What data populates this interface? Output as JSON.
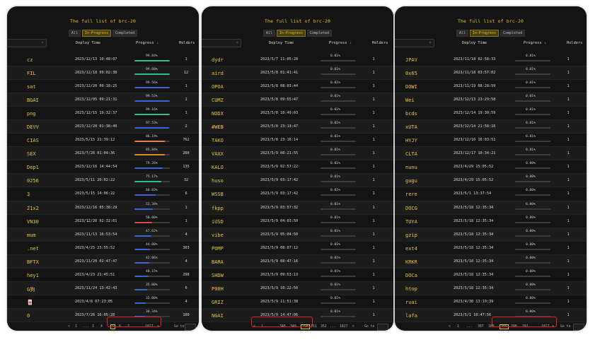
{
  "app": {
    "title": "The full list of brc-20"
  },
  "tabs": [
    "All",
    "In-Progress",
    "Completed"
  ],
  "headers": {
    "deploy_time": "Deploy Time",
    "progress": "Progress",
    "sort_arrow": "↓",
    "holders": "Holders"
  },
  "colors": {
    "accent": "#e8c23a",
    "bar_green": "#2fbf8a",
    "bar_blue": "#3a63d8",
    "bar_red": "#e04848",
    "bar_orange": "#e0852a",
    "highlight": "#e0202a"
  },
  "panels": [
    {
      "rows": [
        {
          "ticker": "cz",
          "time": "2023/12/13 10:48:07",
          "progress": "99.84%",
          "level": 0.998,
          "color": "green",
          "holders": "1"
        },
        {
          "ticker": "FIL",
          "time": "2023/12/18 09:02:38",
          "progress": "99.60%",
          "level": 0.996,
          "color": "green",
          "holders": "12"
        },
        {
          "ticker": "sat",
          "time": "2023/12/20 00:10:25",
          "progress": "99.56%",
          "level": 0.995,
          "color": "blue",
          "holders": "1"
        },
        {
          "ticker": "BGAI",
          "time": "2023/12/05 09:21:31",
          "progress": "99.53%",
          "level": 0.995,
          "color": "blue",
          "holders": "1"
        },
        {
          "ticker": "png",
          "time": "2023/12/15 19:32:37",
          "progress": "99.16%",
          "level": 0.991,
          "color": "green",
          "holders": "1"
        },
        {
          "ticker": "DEVV",
          "time": "2023/12/20 01:38:40",
          "progress": "97.53%",
          "level": 0.975,
          "color": "blue",
          "holders": "2"
        },
        {
          "ticker": "CIAS",
          "time": "2023/5/15 21:39:12",
          "progress": "86.19%",
          "level": 0.862,
          "color": "orange",
          "holders": "762"
        },
        {
          "ticker": "SEX",
          "time": "2023/7/26 01:04:36",
          "progress": "85.84%",
          "level": 0.858,
          "color": "orange",
          "holders": "260"
        },
        {
          "ticker": "Dep1",
          "time": "2023/12/16 14:44:54",
          "progress": "79.26%",
          "level": 0.793,
          "color": "blue",
          "holders": "135"
        },
        {
          "ticker": "0256",
          "time": "2023/5/11 20:02:22",
          "progress": "75.17%",
          "level": 0.752,
          "color": "green",
          "holders": "32"
        },
        {
          "ticker": "3",
          "time": "2023/5/15 14:06:22",
          "progress": "60.03%",
          "level": 0.6,
          "color": "blue",
          "holders": "6"
        },
        {
          "ticker": "21x2",
          "time": "2023/12/16 05:38:29",
          "progress": "52.38%",
          "level": 0.524,
          "color": "blue",
          "holders": "1"
        },
        {
          "ticker": "VN30",
          "time": "2023/12/20 02:32:01",
          "progress": "50.00%",
          "level": 0.5,
          "color": "red",
          "holders": "1"
        },
        {
          "ticker": "mum",
          "time": "2023/11/13 16:53:54",
          "progress": "47.62%",
          "level": 0.476,
          "color": "blue",
          "holders": "4"
        },
        {
          "ticker": ".net",
          "time": "2023/4/25 23:55:52",
          "progress": "44.00%",
          "level": 0.44,
          "color": "blue",
          "holders": "303"
        },
        {
          "ticker": "BFTX",
          "time": "2023/11/20 02:47:47",
          "progress": "42.86%",
          "level": 0.429,
          "color": "blue",
          "holders": "4"
        },
        {
          "ticker": "hey1",
          "time": "2023/4/23 21:45:51",
          "progress": "40.15%",
          "level": 0.402,
          "color": "blue",
          "holders": "298"
        },
        {
          "ticker": "G狗",
          "time": "2023/11/24 13:42:43",
          "progress": "35.00%",
          "level": 0.35,
          "color": "blue",
          "holders": "6"
        },
        {
          "ticker": "🀄",
          "time": "2023/4/8 07:23:05",
          "progress": "32.00%",
          "level": 0.32,
          "color": "blue",
          "holders": "4"
        },
        {
          "ticker": "0",
          "time": "2023/7/26 16:05:28",
          "progress": "30.34%",
          "level": 0.303,
          "color": "blue",
          "holders": "100"
        }
      ],
      "pager": [
        "<",
        "1",
        "...",
        "3",
        "4",
        "5",
        "6",
        "7",
        "...",
        "1827",
        ">"
      ],
      "current": "5",
      "goto": "Go to",
      "goto_suffix": "Page"
    },
    {
      "rows": [
        {
          "ticker": "dydr",
          "time": "2023/5/7 11:05:28",
          "progress": "0.01%",
          "level": 0.0001,
          "color": "blue",
          "holders": "1"
        },
        {
          "ticker": "aird",
          "time": "2023/5/8 01:41:41",
          "progress": "0.01%",
          "level": 0.0001,
          "color": "blue",
          "holders": "1"
        },
        {
          "ticker": "OPOA",
          "time": "2023/5/8 08:03:44",
          "progress": "0.01%",
          "level": 0.0001,
          "color": "blue",
          "holders": "1"
        },
        {
          "ticker": "CUMZ",
          "time": "2023/5/8 09:55:47",
          "progress": "0.01%",
          "level": 0.0001,
          "color": "blue",
          "holders": "1"
        },
        {
          "ticker": "NODX",
          "time": "2023/5/8 10:49:03",
          "progress": "0.01%",
          "level": 0.0001,
          "color": "blue",
          "holders": "1"
        },
        {
          "ticker": "#WEB",
          "time": "2023/5/8 23:13:47",
          "progress": "0.01%",
          "level": 0.0001,
          "color": "blue",
          "holders": "1"
        },
        {
          "ticker": "TAKO",
          "time": "2023/5/8 23:16:14",
          "progress": "0.01%",
          "level": 0.0001,
          "color": "blue",
          "holders": "1"
        },
        {
          "ticker": "VAXX",
          "time": "2023/5/9 00:21:55",
          "progress": "0.01%",
          "level": 0.0001,
          "color": "blue",
          "holders": "1"
        },
        {
          "ticker": "KALO",
          "time": "2023/5/9 02:57:22",
          "progress": "0.01%",
          "level": 0.0001,
          "color": "blue",
          "holders": "1"
        },
        {
          "ticker": "huso",
          "time": "2023/5/9 03:17:42",
          "progress": "0.01%",
          "level": 0.0001,
          "color": "blue",
          "holders": "1"
        },
        {
          "ticker": "WSSB",
          "time": "2023/5/9 03:17:42",
          "progress": "0.01%",
          "level": 0.0001,
          "color": "blue",
          "holders": "1"
        },
        {
          "ticker": "fkpp",
          "time": "2023/5/9 03:57:32",
          "progress": "0.01%",
          "level": 0.0001,
          "color": "blue",
          "holders": "1"
        },
        {
          "ticker": "iUSD",
          "time": "2023/5/9 04:03:50",
          "progress": "0.01%",
          "level": 0.0001,
          "color": "blue",
          "holders": "1"
        },
        {
          "ticker": "vibe",
          "time": "2023/5/9 05:04:50",
          "progress": "0.01%",
          "level": 0.0001,
          "color": "blue",
          "holders": "1"
        },
        {
          "ticker": "POMP",
          "time": "2023/5/9 08:07:12",
          "progress": "0.01%",
          "level": 0.0001,
          "color": "blue",
          "holders": "1"
        },
        {
          "ticker": "BARA",
          "time": "2023/5/9 08:47:16",
          "progress": "0.01%",
          "level": 0.0001,
          "color": "blue",
          "holders": "1"
        },
        {
          "ticker": "SHDW",
          "time": "2023/5/9 09:53:13",
          "progress": "0.01%",
          "level": 0.0001,
          "color": "blue",
          "holders": "1"
        },
        {
          "ticker": "P00H",
          "time": "2023/5/9 10:22:50",
          "progress": "0.01%",
          "level": 0.0001,
          "color": "blue",
          "holders": "1"
        },
        {
          "ticker": "GRIZ",
          "time": "2023/5/9 11:51:38",
          "progress": "0.01%",
          "level": 0.0001,
          "color": "blue",
          "holders": "1"
        },
        {
          "ticker": "NGAI",
          "time": "2023/5/9 14:47:06",
          "progress": "0.01%",
          "level": 0.0001,
          "color": "blue",
          "holders": "1"
        }
      ],
      "pager": [
        "<",
        "1",
        "...",
        "348",
        "349",
        "350",
        "351",
        "352",
        "...",
        "1827",
        ">"
      ],
      "current": "350",
      "goto": "Go to",
      "goto_suffix": ""
    },
    {
      "rows": [
        {
          "ticker": "JPAV",
          "time": "2023/11/18 02:58:33",
          "progress": "0.01%",
          "level": 0.0001,
          "color": "blue",
          "holders": "1"
        },
        {
          "ticker": "0x65",
          "time": "2023/11/18 03:57:02",
          "progress": "0.01%",
          "level": 0.0001,
          "color": "blue",
          "holders": "1"
        },
        {
          "ticker": "DOWI",
          "time": "2023/11/19 08:28:59",
          "progress": "0.01%",
          "level": 0.0001,
          "color": "blue",
          "holders": "1"
        },
        {
          "ticker": "Wei",
          "time": "2023/12/13 23:29:58",
          "progress": "0.01%",
          "level": 0.0001,
          "color": "blue",
          "holders": "1"
        },
        {
          "ticker": "bcds",
          "time": "2023/12/14 19:30:59",
          "progress": "0.01%",
          "level": 0.0001,
          "color": "blue",
          "holders": "1"
        },
        {
          "ticker": "xUTA",
          "time": "2023/12/14 21:58:16",
          "progress": "0.01%",
          "level": 0.0001,
          "color": "blue",
          "holders": "1"
        },
        {
          "ticker": "HYJY",
          "time": "2023/12/16 16:03:51",
          "progress": "0.01%",
          "level": 0.0001,
          "color": "blue",
          "holders": "1"
        },
        {
          "ticker": "CLTA",
          "time": "2023/12/17 10:34:21",
          "progress": "0.01%",
          "level": 0.0001,
          "color": "blue",
          "holders": "1"
        },
        {
          "ticker": "nunu",
          "time": "2023/4/29 15:05:52",
          "progress": "0.00%",
          "level": 0.0,
          "color": "blue",
          "holders": "1"
        },
        {
          "ticker": "gugu",
          "time": "2023/4/29 15:05:52",
          "progress": "0.00%",
          "level": 0.0,
          "color": "blue",
          "holders": "1"
        },
        {
          "ticker": "rere",
          "time": "2023/5/1 13:37:54",
          "progress": "0.00%",
          "level": 0.0,
          "color": "blue",
          "holders": "1"
        },
        {
          "ticker": "DOCG",
          "time": "2023/5/18 12:35:34",
          "progress": "0.00%",
          "level": 0.0,
          "color": "blue",
          "holders": "1"
        },
        {
          "ticker": "TUYA",
          "time": "2023/5/18 12:35:34",
          "progress": "0.00%",
          "level": 0.0,
          "color": "blue",
          "holders": "1"
        },
        {
          "ticker": "gzip",
          "time": "2023/5/18 12:35:34",
          "progress": "0.00%",
          "level": 0.0,
          "color": "blue",
          "holders": "1"
        },
        {
          "ticker": "ext4",
          "time": "2023/5/18 12:35:34",
          "progress": "0.00%",
          "level": 0.0,
          "color": "blue",
          "holders": "1"
        },
        {
          "ticker": "KRKR",
          "time": "2023/5/18 12:35:34",
          "progress": "0.00%",
          "level": 0.0,
          "color": "blue",
          "holders": "1"
        },
        {
          "ticker": "DOCa",
          "time": "2023/5/18 12:35:34",
          "progress": "0.00%",
          "level": 0.0,
          "color": "blue",
          "holders": "1"
        },
        {
          "ticker": "htop",
          "time": "2023/5/18 12:35:34",
          "progress": "0.00%",
          "level": 0.0,
          "color": "blue",
          "holders": "1"
        },
        {
          "ticker": "ruai",
          "time": "2023/4/30 13:19:39",
          "progress": "0.00%",
          "level": 0.0,
          "color": "blue",
          "holders": "1"
        },
        {
          "ticker": "lafa",
          "time": "2023/5/1 10:47:56",
          "progress": "0.00%",
          "level": 0.0,
          "color": "blue",
          "holders": "1"
        }
      ],
      "pager": [
        "<",
        "1",
        "...",
        "387",
        "388",
        "389",
        "390",
        "391",
        "...",
        "1827",
        ">"
      ],
      "current": "389",
      "goto": "Go to",
      "goto_suffix": ""
    }
  ]
}
